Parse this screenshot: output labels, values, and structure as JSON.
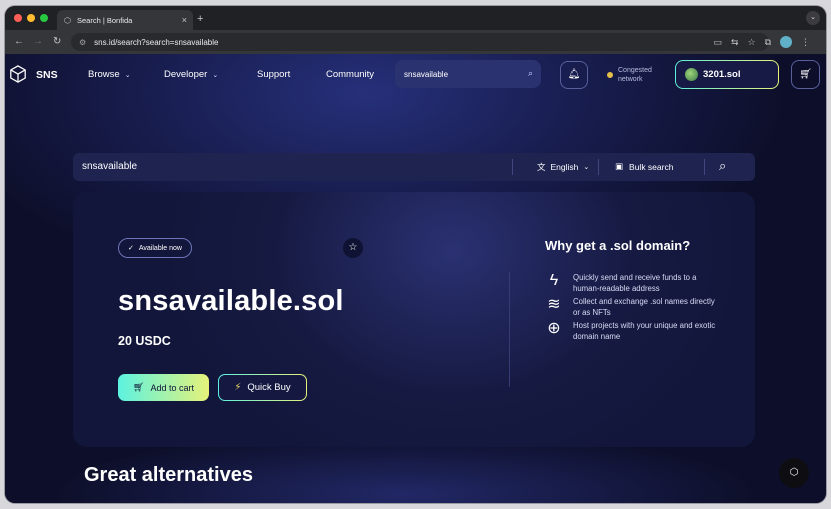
{
  "browser": {
    "tab_title": "Search | Bonfida",
    "url": "sns.id/search?search=snsavailable",
    "new_tab": "+",
    "close": "×"
  },
  "nav": {
    "brand": "SNS",
    "menu": [
      "Browse",
      "Developer",
      "Support",
      "Community"
    ],
    "search_value": "snsavailable",
    "network_status": "Congested network",
    "wallet": "3201.sol"
  },
  "search": {
    "query": "snsavailable",
    "language": "English",
    "bulk_label": "Bulk search"
  },
  "result": {
    "badge": "Available now",
    "domain": "snsavailable.sol",
    "price": "20 USDC",
    "add_to_cart": "Add to cart",
    "quick_buy": "Quick Buy"
  },
  "why": {
    "title": "Why get a .sol domain?",
    "features": [
      {
        "icon": "lightning-icon",
        "text": "Quickly send and receive funds to a human-readable address"
      },
      {
        "icon": "layers-icon",
        "text": "Collect and exchange .sol names directly or as NFTs"
      },
      {
        "icon": "globe-icon",
        "text": "Host projects with your unique and exotic domain name"
      }
    ]
  },
  "alternatives_title": "Great alternatives",
  "colors": {
    "accent_gradient_start": "#5cf2e0",
    "accent_gradient_end": "#e6f27a",
    "page_bg": "#171c4c",
    "congested": "#e4c04a"
  }
}
